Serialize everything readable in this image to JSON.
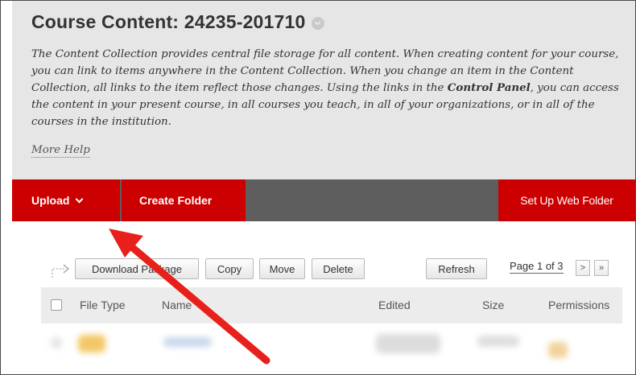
{
  "page": {
    "title": "Course Content: 24235-201710",
    "desc_1": "The Content Collection provides central file storage for all content. When creating content for your course, you can link to items anywhere in the Content Collection. When you change an item in the Content Collection, all links to the item reflect those changes. Using the links in the ",
    "desc_bold": "Control Panel",
    "desc_2": ", you can access the content in your present course, in all courses you teach, in all of your organizations, or in all of the courses in the institution.",
    "more_help": "More Help"
  },
  "action_bar": {
    "upload": "Upload",
    "create_folder": "Create Folder",
    "set_up_web_folder": "Set Up Web Folder",
    "accent_color": "#cc0000"
  },
  "toolbar": {
    "download_package": "Download Package",
    "copy": "Copy",
    "move": "Move",
    "delete": "Delete",
    "refresh": "Refresh",
    "page_info": "Page 1 of 3",
    "next": ">",
    "last": "»"
  },
  "table": {
    "columns": [
      "File Type",
      "Name",
      "Edited",
      "Size",
      "Permissions"
    ]
  },
  "annotation": {
    "color": "#e8201b",
    "icon": "red-arrow-annotation"
  }
}
